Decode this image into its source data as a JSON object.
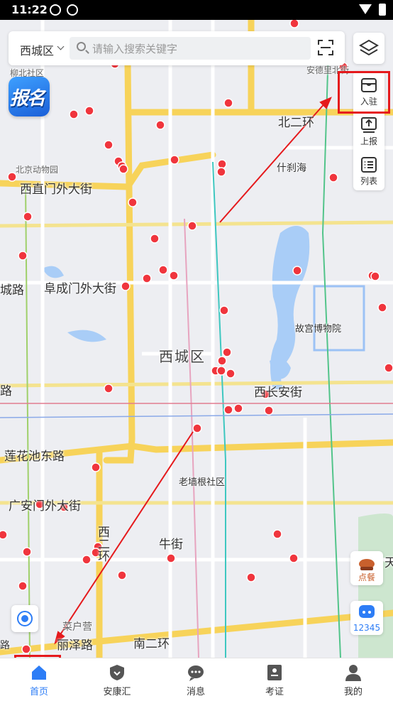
{
  "status_bar": {
    "time": "11:22"
  },
  "search": {
    "district": "西城区",
    "placeholder": "请输入搜索关键字"
  },
  "signup_badge": {
    "text": "报名"
  },
  "side_panel": {
    "items": [
      {
        "label": "入驻",
        "icon": "store-icon"
      },
      {
        "label": "上报",
        "icon": "upload-icon"
      },
      {
        "label": "列表",
        "icon": "list-icon"
      }
    ]
  },
  "floating": {
    "order_label": "点餐",
    "hotline_label": "12345"
  },
  "map_labels": {
    "district_center": "西城区",
    "beierhuan": "北二环",
    "xizhimenwai": "西直门外大街",
    "fuchengmenwai": "阜成门外大街",
    "xichang_an": "西长安街",
    "lianhuachi": "莲花池东路",
    "guang_anmenwai": "广安门外大街",
    "niujie": "牛街",
    "nanerhuan": "南二环",
    "lizelu": "丽泽路",
    "shichahai": "什刹海",
    "gugong": "故宫博物院",
    "zoo": "北京动物园",
    "laoqianggen": "老墙根社区",
    "liubei": "柳北社区",
    "andeli": "安德里北街",
    "caihuying": "菜户营",
    "xiercheng": "西二环",
    "chenglu": "城路",
    "lu": "路",
    "lu2": "路",
    "tian": "天"
  },
  "tabs": [
    {
      "label": "首页",
      "icon": "home-icon",
      "active": true
    },
    {
      "label": "安康汇",
      "icon": "shield-icon",
      "active": false
    },
    {
      "label": "消息",
      "icon": "message-icon",
      "active": false
    },
    {
      "label": "考证",
      "icon": "certificate-icon",
      "active": false
    },
    {
      "label": "我的",
      "icon": "user-icon",
      "active": false
    }
  ],
  "colors": {
    "accent": "#2d7df6",
    "highlight": "#e5191c",
    "poi": "#f0353d"
  }
}
